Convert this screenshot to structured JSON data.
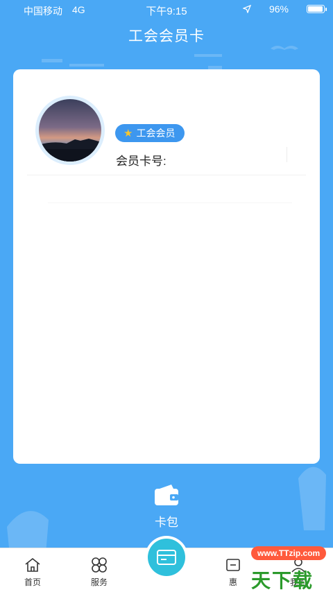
{
  "status_bar": {
    "carrier": "中国移动",
    "network": "4G",
    "time": "下午9:15",
    "battery": "96%",
    "battery_level": 0.96
  },
  "header": {
    "title": "工会会员卡"
  },
  "card": {
    "badge_label": "工会会员",
    "card_number_label": "会员卡号:"
  },
  "wallet": {
    "label": "卡包"
  },
  "tabbar": {
    "items": [
      {
        "label": "首页",
        "icon": "home-icon"
      },
      {
        "label": "服务",
        "icon": "grid-icon"
      },
      {
        "label": "",
        "icon": "card-icon"
      },
      {
        "label": "惠",
        "icon": "discount-icon"
      },
      {
        "label": "我的",
        "icon": "user-icon"
      }
    ]
  },
  "watermark": {
    "pill": "www.TTzip.com",
    "text": "天下载"
  },
  "colors": {
    "background": "#4aa8f5",
    "badge": "#3d97ef",
    "center_button": "#2fc0dc"
  }
}
